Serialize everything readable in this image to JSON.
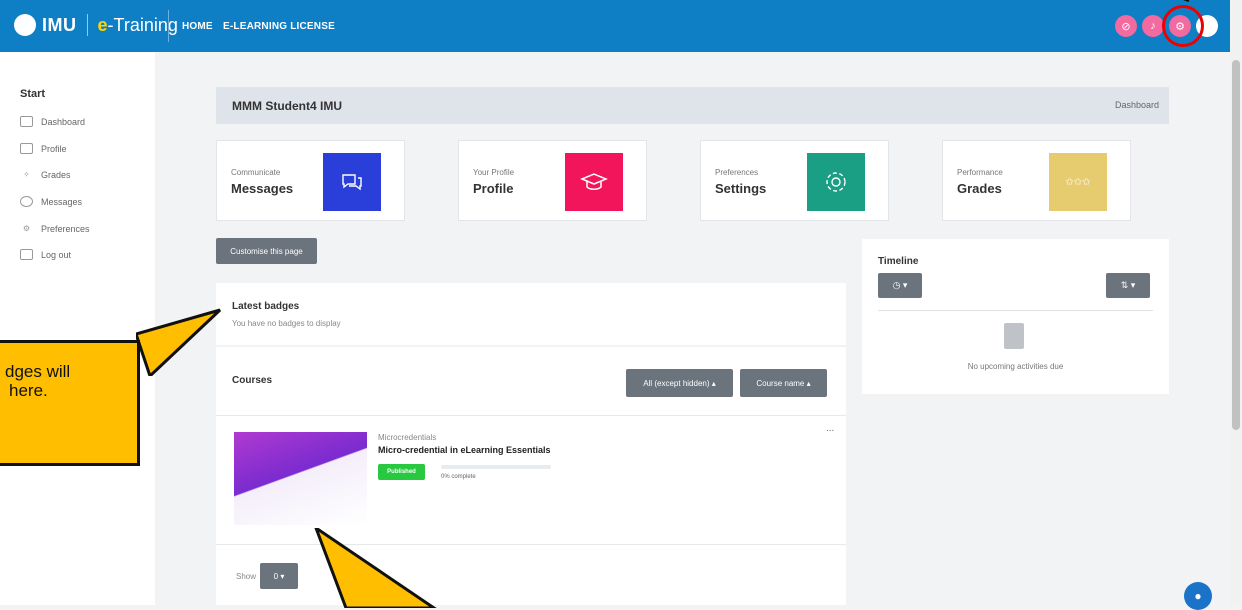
{
  "header": {
    "logo_imu": "IMU",
    "logo_e": "e",
    "logo_training": "-Training",
    "nav": [
      "HOME",
      "E-LEARNING LICENSE"
    ]
  },
  "sidebar": {
    "title": "Start",
    "items": [
      {
        "label": "Dashboard",
        "icon": "dashboard-icon"
      },
      {
        "label": "Profile",
        "icon": "profile-icon"
      },
      {
        "label": "Grades",
        "icon": "grades-icon"
      },
      {
        "label": "Messages",
        "icon": "messages-icon"
      },
      {
        "label": "Preferences",
        "icon": "preferences-icon"
      },
      {
        "label": "Log out",
        "icon": "logout-icon"
      }
    ]
  },
  "page": {
    "title": "MMM Student4 IMU",
    "breadcrumb": "Dashboard"
  },
  "cards": [
    {
      "sub": "Communicate",
      "title": "Messages",
      "color": "#2a3fd9",
      "icon": "chat-icon"
    },
    {
      "sub": "Your Profile",
      "title": "Profile",
      "color": "#f2155b",
      "icon": "graduation-cap-icon"
    },
    {
      "sub": "Preferences",
      "title": "Settings",
      "color": "#1a9e84",
      "icon": "gear-icon"
    },
    {
      "sub": "Performance",
      "title": "Grades",
      "color": "#e6cc6e",
      "icon": "stars-hand-icon"
    }
  ],
  "customise_label": "Customise this page",
  "badges": {
    "title": "Latest badges",
    "empty": "You have no badges to display"
  },
  "courses": {
    "title": "Courses",
    "filter_label": "All (except hidden) ▴",
    "sort_label": "Course name ▴",
    "item": {
      "category": "Microcredentials",
      "name": "Micro-credential in eLearning Essentials",
      "badge": "Published",
      "progress_percent": 0,
      "progress_text": "0% complete",
      "menu": "..."
    },
    "show_label": "Show",
    "show_value": "0 ▾"
  },
  "timeline": {
    "title": "Timeline",
    "filter_btn": "◷ ▾",
    "sort_btn": "⇅ ▾",
    "empty": "No upcoming activities due"
  },
  "callout": {
    "text_line1": "dges will",
    "text_line2": "here."
  }
}
